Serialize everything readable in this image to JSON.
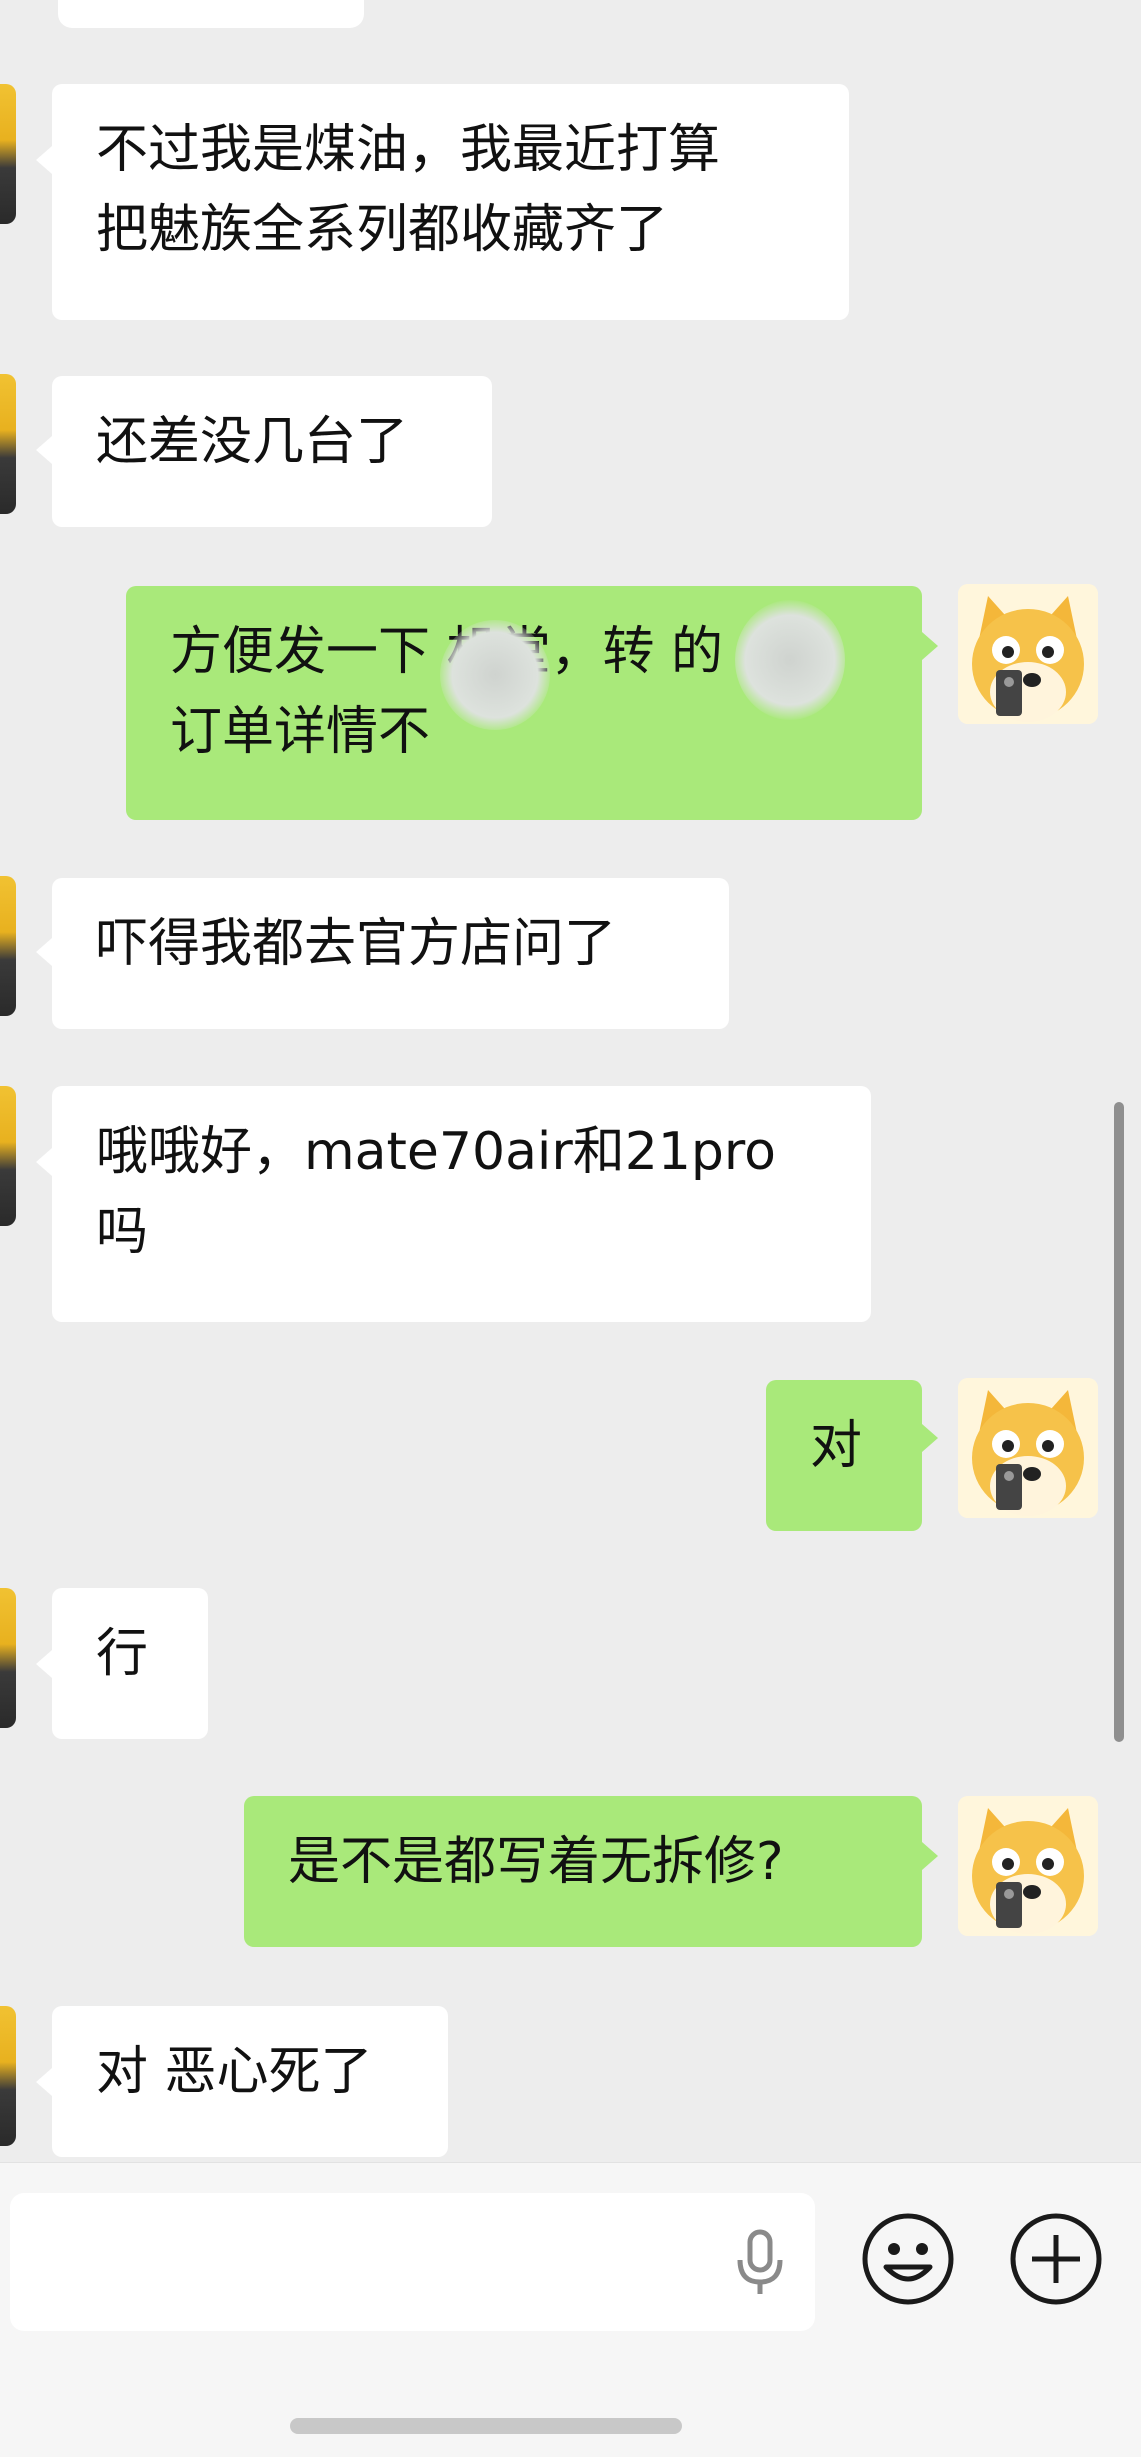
{
  "messages": [
    {
      "side": "in",
      "lines": [
        "不过我是煤油，我最近打算",
        "把魅族全系列都收藏齐了"
      ]
    },
    {
      "side": "in",
      "lines": [
        "还差没几台了"
      ]
    },
    {
      "side": "out",
      "lines": [
        "方便发一下   机堂，转   的",
        "订单详情不"
      ]
    },
    {
      "side": "in",
      "lines": [
        "吓得我都去官方店问了"
      ]
    },
    {
      "side": "in",
      "lines": [
        "哦哦好，mate70air和21pro",
        "吗"
      ]
    },
    {
      "side": "out",
      "lines": [
        "对"
      ]
    },
    {
      "side": "in",
      "lines": [
        "行"
      ]
    },
    {
      "side": "out",
      "lines": [
        "是不是都写着无拆修?"
      ]
    },
    {
      "side": "in",
      "lines": [
        "对 恶心死了"
      ]
    }
  ],
  "input": {
    "icons": [
      "microphone-icon",
      "emoji-icon",
      "plus-icon"
    ]
  },
  "colors": {
    "background": "#ededed",
    "incoming_bubble": "#ffffff",
    "outgoing_bubble": "#a9e97a"
  }
}
